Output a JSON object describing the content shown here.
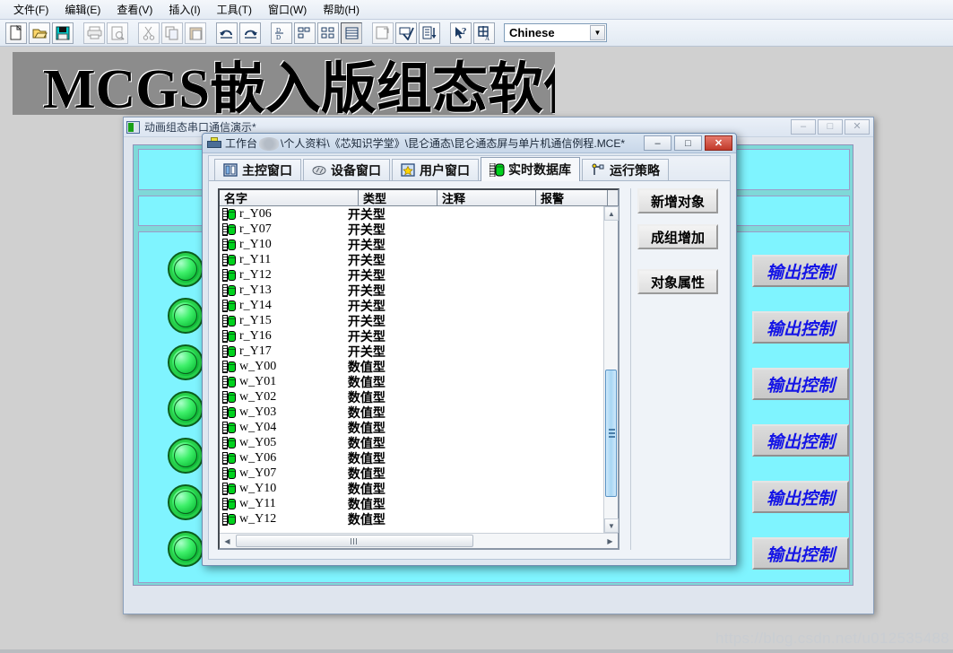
{
  "app": {
    "menu": [
      {
        "label": "文件(F)",
        "name": "menu-file"
      },
      {
        "label": "编辑(E)",
        "name": "menu-edit"
      },
      {
        "label": "查看(V)",
        "name": "menu-view"
      },
      {
        "label": "插入(I)",
        "name": "menu-insert"
      },
      {
        "label": "工具(T)",
        "name": "menu-tools"
      },
      {
        "label": "窗口(W)",
        "name": "menu-window"
      },
      {
        "label": "帮助(H)",
        "name": "menu-help"
      }
    ],
    "toolbar": {
      "icons": [
        "new-file-icon",
        "open-folder-icon",
        "save-icon",
        "print-icon",
        "print-preview-icon",
        "cut-icon",
        "copy-icon",
        "paste-icon",
        "undo-icon",
        "redo-icon",
        "align-left-icon",
        "align-distribute-icon",
        "list-view-icon",
        "table-view-icon",
        "properties-icon",
        "spell-check-icon",
        "sort-icon",
        "help-pointer-icon",
        "ime-icon"
      ],
      "language_select": "Chinese"
    },
    "banner_text": "MCGS嵌入版组态软件"
  },
  "mdi_window": {
    "title": "动画组态串口通信演示*",
    "icon": "window-doc-icon",
    "controls": [
      {
        "name": "minimize-button",
        "glyph": "–"
      },
      {
        "name": "maximize-button",
        "glyph": "□"
      },
      {
        "name": "close-button",
        "glyph": "✕"
      }
    ],
    "output_buttons": [
      "输出控制",
      "输出控制",
      "输出控制",
      "输出控制",
      "输出控制",
      "输出控制"
    ],
    "lamp_count": 7
  },
  "workbench": {
    "icon": "workbench-icon",
    "title_prefix": "工作台",
    "title_path": "\\个人资料\\《芯知识学堂》\\昆仑通态\\昆仑通态屏与单片机通信例程.MCE*",
    "controls": [
      {
        "name": "minimize-button",
        "glyph": "–"
      },
      {
        "name": "maximize-button",
        "glyph": "□"
      },
      {
        "name": "close-button",
        "glyph": "✕"
      }
    ],
    "tabs": [
      {
        "label": "主控窗口",
        "icon": "main-window-icon",
        "active": false
      },
      {
        "label": "设备窗口",
        "icon": "device-window-icon",
        "active": false
      },
      {
        "label": "用户窗口",
        "icon": "user-window-icon",
        "active": false
      },
      {
        "label": "实时数据库",
        "icon": "realtime-db-icon",
        "active": true
      },
      {
        "label": "运行策略",
        "icon": "run-strategy-icon",
        "active": false
      }
    ],
    "table": {
      "columns": [
        "名字",
        "类型",
        "注释",
        "报警"
      ],
      "rows": [
        {
          "name": "r_Y06",
          "type": "开关型",
          "comment": "",
          "alarm": ""
        },
        {
          "name": "r_Y07",
          "type": "开关型",
          "comment": "",
          "alarm": ""
        },
        {
          "name": "r_Y10",
          "type": "开关型",
          "comment": "",
          "alarm": ""
        },
        {
          "name": "r_Y11",
          "type": "开关型",
          "comment": "",
          "alarm": ""
        },
        {
          "name": "r_Y12",
          "type": "开关型",
          "comment": "",
          "alarm": ""
        },
        {
          "name": "r_Y13",
          "type": "开关型",
          "comment": "",
          "alarm": ""
        },
        {
          "name": "r_Y14",
          "type": "开关型",
          "comment": "",
          "alarm": ""
        },
        {
          "name": "r_Y15",
          "type": "开关型",
          "comment": "",
          "alarm": ""
        },
        {
          "name": "r_Y16",
          "type": "开关型",
          "comment": "",
          "alarm": ""
        },
        {
          "name": "r_Y17",
          "type": "开关型",
          "comment": "",
          "alarm": ""
        },
        {
          "name": "w_Y00",
          "type": "数值型",
          "comment": "",
          "alarm": ""
        },
        {
          "name": "w_Y01",
          "type": "数值型",
          "comment": "",
          "alarm": ""
        },
        {
          "name": "w_Y02",
          "type": "数值型",
          "comment": "",
          "alarm": ""
        },
        {
          "name": "w_Y03",
          "type": "数值型",
          "comment": "",
          "alarm": ""
        },
        {
          "name": "w_Y04",
          "type": "数值型",
          "comment": "",
          "alarm": ""
        },
        {
          "name": "w_Y05",
          "type": "数值型",
          "comment": "",
          "alarm": ""
        },
        {
          "name": "w_Y06",
          "type": "数值型",
          "comment": "",
          "alarm": ""
        },
        {
          "name": "w_Y07",
          "type": "数值型",
          "comment": "",
          "alarm": ""
        },
        {
          "name": "w_Y10",
          "type": "数值型",
          "comment": "",
          "alarm": ""
        },
        {
          "name": "w_Y11",
          "type": "数值型",
          "comment": "",
          "alarm": ""
        },
        {
          "name": "w_Y12",
          "type": "数值型",
          "comment": "",
          "alarm": ""
        }
      ]
    },
    "buttons": [
      {
        "label": "新增对象",
        "name": "add-object-button"
      },
      {
        "label": "成组增加",
        "name": "add-group-button"
      },
      {
        "label": "对象属性",
        "name": "object-properties-button"
      }
    ]
  },
  "watermark": "https://blog.csdn.net/u012535488",
  "colors": {
    "accent": "#1414e6",
    "lamp_green": "#12c23c",
    "panel_cyan": "#7ff4ff",
    "close_red": "#c1392a"
  }
}
